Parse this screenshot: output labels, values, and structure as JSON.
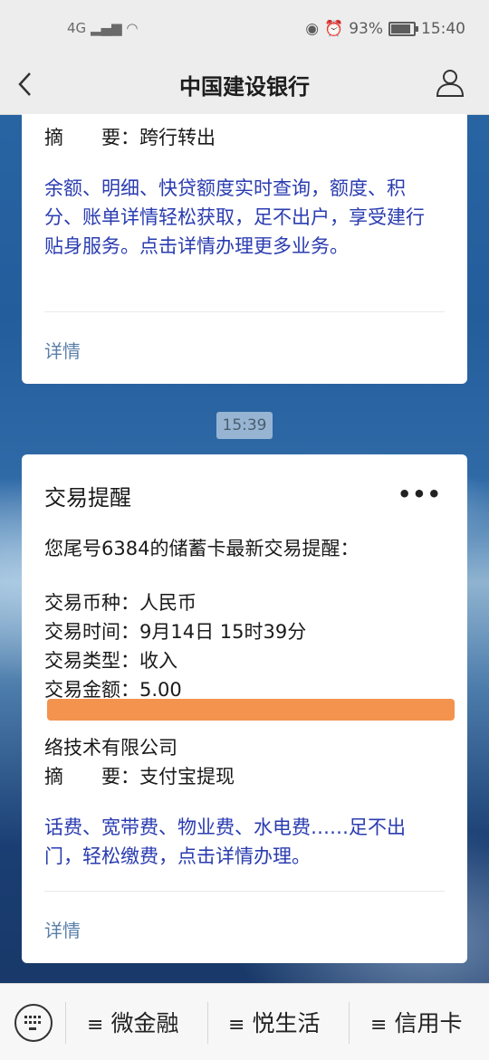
{
  "status_bar": {
    "network": "4G",
    "battery": "93%",
    "time": "15:40"
  },
  "header": {
    "back_icon": "chevron-left-icon",
    "title": "中国建设银行",
    "user_icon": "person-icon"
  },
  "card_1": {
    "summary_line": "摘　　要：跨行转出",
    "promo": "余额、明细、快贷额度实时查询，额度、积分、账单详情轻松获取，足不出户，享受建行贴身服务。点击详情办理更多业务。",
    "detail_link": "详情"
  },
  "timestamp": "15:39",
  "card_2": {
    "title": "交易提醒",
    "more_icon": "more-dots-icon",
    "intro": "您尾号6384的储蓄卡最新交易提醒：",
    "currency": "交易币种：人民币",
    "time": "交易时间：9月14日 15时39分",
    "type": "交易类型：收入",
    "amount": "交易金额：5.00",
    "counterparty_tail": "络技术有限公司",
    "summary_line": "摘　　要：支付宝提现",
    "promo": "话费、宽带费、物业费、水电费……足不出门，轻松缴费，点击详情办理。",
    "detail_link": "详情"
  },
  "tab_bar": {
    "keyboard_icon": "keyboard-icon",
    "tabs": [
      {
        "label": "微金融"
      },
      {
        "label": "悦生活"
      },
      {
        "label": "信用卡"
      }
    ]
  },
  "colors": {
    "link_blue": "#2a3cb0",
    "detail_blue": "#5a7fa8",
    "redaction": "#f3934e"
  }
}
